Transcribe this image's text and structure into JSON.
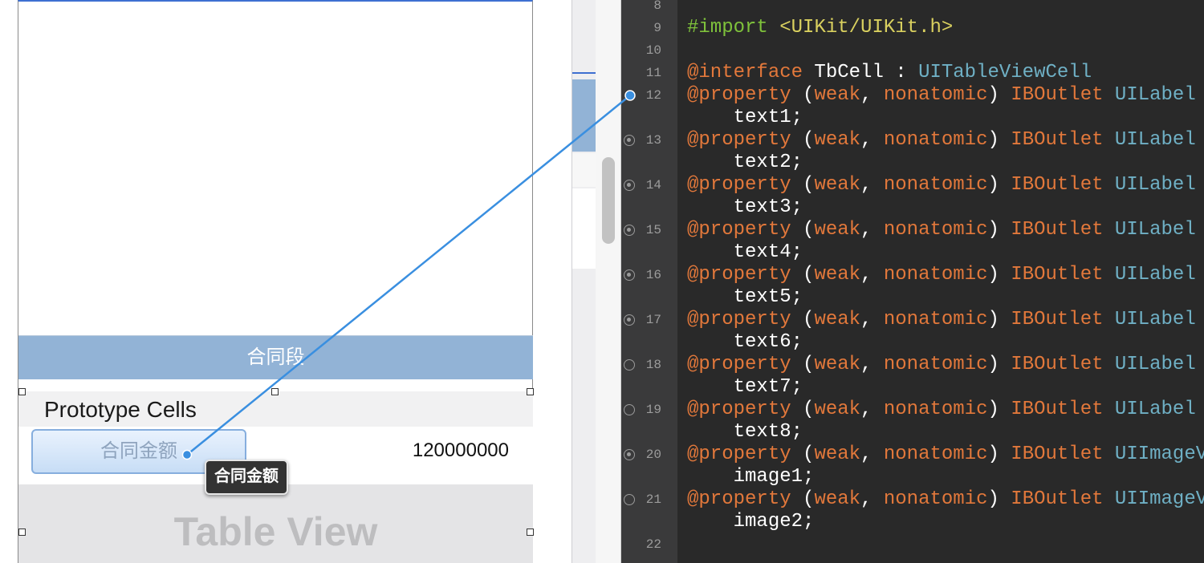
{
  "interface_builder": {
    "section_header": "合同段",
    "prototype_header": "Prototype Cells",
    "cell": {
      "label_text": "合同金额",
      "value_text": "120000000"
    },
    "table_view_watermark": "Table View",
    "connection_tooltip": "合同金额"
  },
  "editor": {
    "colors": {
      "background": "#292929",
      "preprocessor": "#7ec13b",
      "include": "#d9d05f",
      "keyword": "#e2783b",
      "type": "#6fb0c5",
      "connection_line": "#3a8fe0"
    },
    "lines": [
      {
        "gutter": "8",
        "dot": "none",
        "segments": []
      },
      {
        "gutter": "9",
        "dot": "none",
        "segments": [
          {
            "t": "#import",
            "c": "kw-pre"
          },
          {
            "t": " "
          },
          {
            "t": "<UIKit/UIKit.h>",
            "c": "kw-inc"
          }
        ]
      },
      {
        "gutter": "10",
        "dot": "none",
        "segments": []
      },
      {
        "gutter": "11",
        "dot": "none",
        "segments": [
          {
            "t": "@interface",
            "c": "kw-at"
          },
          {
            "t": " TbCell : "
          },
          {
            "t": "UITableViewCell",
            "c": "kw-type"
          }
        ]
      },
      {
        "gutter": "12",
        "dot": "connecting",
        "segments": [
          {
            "t": "@property",
            "c": "kw-at"
          },
          {
            "t": " ("
          },
          {
            "t": "weak",
            "c": "kw-at"
          },
          {
            "t": ", "
          },
          {
            "t": "nonatomic",
            "c": "kw-at"
          },
          {
            "t": ") "
          },
          {
            "t": "IBOutlet",
            "c": "kw-at"
          },
          {
            "t": " "
          },
          {
            "t": "UILabel",
            "c": "kw-type"
          }
        ]
      },
      {
        "gutter": "",
        "dot": "none",
        "segments": [
          {
            "t": "    text1;"
          }
        ]
      },
      {
        "gutter": "13",
        "dot": "filled",
        "segments": [
          {
            "t": "@property",
            "c": "kw-at"
          },
          {
            "t": " ("
          },
          {
            "t": "weak",
            "c": "kw-at"
          },
          {
            "t": ", "
          },
          {
            "t": "nonatomic",
            "c": "kw-at"
          },
          {
            "t": ") "
          },
          {
            "t": "IBOutlet",
            "c": "kw-at"
          },
          {
            "t": " "
          },
          {
            "t": "UILabel",
            "c": "kw-type"
          }
        ]
      },
      {
        "gutter": "",
        "dot": "none",
        "segments": [
          {
            "t": "    text2;"
          }
        ]
      },
      {
        "gutter": "14",
        "dot": "filled",
        "segments": [
          {
            "t": "@property",
            "c": "kw-at"
          },
          {
            "t": " ("
          },
          {
            "t": "weak",
            "c": "kw-at"
          },
          {
            "t": ", "
          },
          {
            "t": "nonatomic",
            "c": "kw-at"
          },
          {
            "t": ") "
          },
          {
            "t": "IBOutlet",
            "c": "kw-at"
          },
          {
            "t": " "
          },
          {
            "t": "UILabel",
            "c": "kw-type"
          }
        ]
      },
      {
        "gutter": "",
        "dot": "none",
        "segments": [
          {
            "t": "    text3;"
          }
        ]
      },
      {
        "gutter": "15",
        "dot": "filled",
        "segments": [
          {
            "t": "@property",
            "c": "kw-at"
          },
          {
            "t": " ("
          },
          {
            "t": "weak",
            "c": "kw-at"
          },
          {
            "t": ", "
          },
          {
            "t": "nonatomic",
            "c": "kw-at"
          },
          {
            "t": ") "
          },
          {
            "t": "IBOutlet",
            "c": "kw-at"
          },
          {
            "t": " "
          },
          {
            "t": "UILabel",
            "c": "kw-type"
          }
        ]
      },
      {
        "gutter": "",
        "dot": "none",
        "segments": [
          {
            "t": "    text4;"
          }
        ]
      },
      {
        "gutter": "16",
        "dot": "filled",
        "segments": [
          {
            "t": "@property",
            "c": "kw-at"
          },
          {
            "t": " ("
          },
          {
            "t": "weak",
            "c": "kw-at"
          },
          {
            "t": ", "
          },
          {
            "t": "nonatomic",
            "c": "kw-at"
          },
          {
            "t": ") "
          },
          {
            "t": "IBOutlet",
            "c": "kw-at"
          },
          {
            "t": " "
          },
          {
            "t": "UILabel",
            "c": "kw-type"
          }
        ]
      },
      {
        "gutter": "",
        "dot": "none",
        "segments": [
          {
            "t": "    text5;"
          }
        ]
      },
      {
        "gutter": "17",
        "dot": "filled",
        "segments": [
          {
            "t": "@property",
            "c": "kw-at"
          },
          {
            "t": " ("
          },
          {
            "t": "weak",
            "c": "kw-at"
          },
          {
            "t": ", "
          },
          {
            "t": "nonatomic",
            "c": "kw-at"
          },
          {
            "t": ") "
          },
          {
            "t": "IBOutlet",
            "c": "kw-at"
          },
          {
            "t": " "
          },
          {
            "t": "UILabel",
            "c": "kw-type"
          }
        ]
      },
      {
        "gutter": "",
        "dot": "none",
        "segments": [
          {
            "t": "    text6;"
          }
        ]
      },
      {
        "gutter": "18",
        "dot": "empty",
        "segments": [
          {
            "t": "@property",
            "c": "kw-at"
          },
          {
            "t": " ("
          },
          {
            "t": "weak",
            "c": "kw-at"
          },
          {
            "t": ", "
          },
          {
            "t": "nonatomic",
            "c": "kw-at"
          },
          {
            "t": ") "
          },
          {
            "t": "IBOutlet",
            "c": "kw-at"
          },
          {
            "t": " "
          },
          {
            "t": "UILabel",
            "c": "kw-type"
          }
        ]
      },
      {
        "gutter": "",
        "dot": "none",
        "segments": [
          {
            "t": "    text7;"
          }
        ]
      },
      {
        "gutter": "19",
        "dot": "empty",
        "segments": [
          {
            "t": "@property",
            "c": "kw-at"
          },
          {
            "t": " ("
          },
          {
            "t": "weak",
            "c": "kw-at"
          },
          {
            "t": ", "
          },
          {
            "t": "nonatomic",
            "c": "kw-at"
          },
          {
            "t": ") "
          },
          {
            "t": "IBOutlet",
            "c": "kw-at"
          },
          {
            "t": " "
          },
          {
            "t": "UILabel",
            "c": "kw-type"
          }
        ]
      },
      {
        "gutter": "",
        "dot": "none",
        "segments": [
          {
            "t": "    text8;"
          }
        ]
      },
      {
        "gutter": "20",
        "dot": "filled",
        "segments": [
          {
            "t": "@property",
            "c": "kw-at"
          },
          {
            "t": " ("
          },
          {
            "t": "weak",
            "c": "kw-at"
          },
          {
            "t": ", "
          },
          {
            "t": "nonatomic",
            "c": "kw-at"
          },
          {
            "t": ") "
          },
          {
            "t": "IBOutlet",
            "c": "kw-at"
          },
          {
            "t": " "
          },
          {
            "t": "UIImageV",
            "c": "kw-type"
          }
        ]
      },
      {
        "gutter": "",
        "dot": "none",
        "segments": [
          {
            "t": "    image1;"
          }
        ]
      },
      {
        "gutter": "21",
        "dot": "empty",
        "segments": [
          {
            "t": "@property",
            "c": "kw-at"
          },
          {
            "t": " ("
          },
          {
            "t": "weak",
            "c": "kw-at"
          },
          {
            "t": ", "
          },
          {
            "t": "nonatomic",
            "c": "kw-at"
          },
          {
            "t": ") "
          },
          {
            "t": "IBOutlet",
            "c": "kw-at"
          },
          {
            "t": " "
          },
          {
            "t": "UIImageV",
            "c": "kw-type"
          }
        ]
      },
      {
        "gutter": "",
        "dot": "none",
        "segments": [
          {
            "t": "    image2;"
          }
        ]
      },
      {
        "gutter": "22",
        "dot": "none",
        "segments": []
      }
    ]
  }
}
